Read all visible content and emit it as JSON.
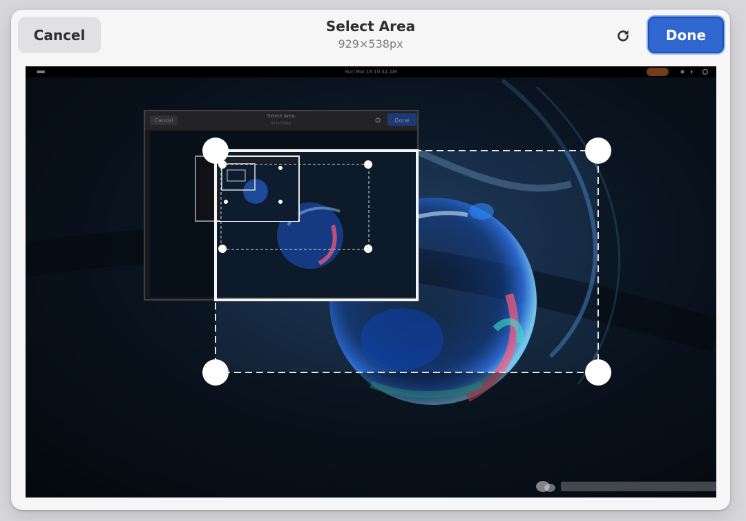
{
  "header": {
    "cancel_label": "Cancel",
    "title": "Select Area",
    "subtitle": "929×538px",
    "reload_icon": "reload-icon",
    "done_label": "Done"
  },
  "desktop": {
    "clock": "Sun Mar 16  10:41 AM"
  },
  "nested_dialog": {
    "cancel_label": "Cancel",
    "title": "Select Area",
    "subtitle": "929×538px",
    "done_label": "Done"
  },
  "colors": {
    "accent": "#2f66cf",
    "dialog_bg": "#f6f6f6",
    "cancel_bg": "#e1e1e3"
  }
}
